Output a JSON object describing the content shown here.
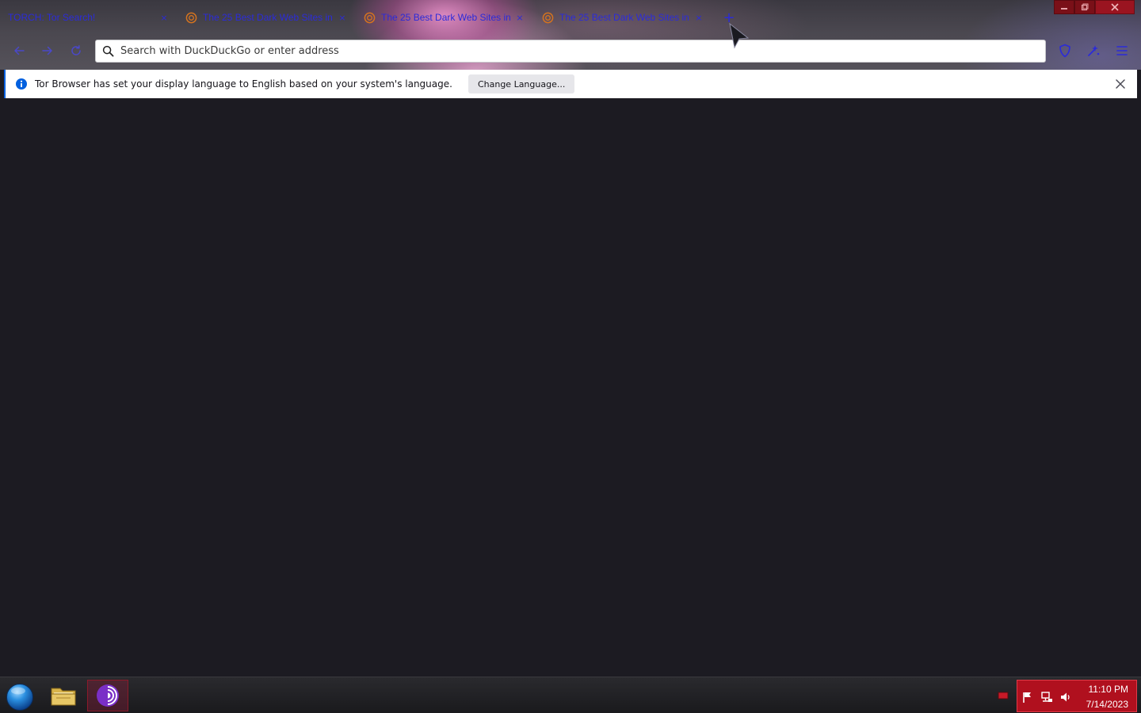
{
  "tabs": [
    {
      "title": "TORCH: Tor Search!",
      "has_favicon": false
    },
    {
      "title": "The 25 Best Dark Web Sites in ...",
      "has_favicon": true
    },
    {
      "title": "The 25 Best Dark Web Sites in ...",
      "has_favicon": true
    },
    {
      "title": "The 25 Best Dark Web Sites in ...",
      "has_favicon": true
    }
  ],
  "tab_close_glyph": "×",
  "new_tab_glyph": "+",
  "urlbar": {
    "placeholder": "Search with DuckDuckGo or enter address",
    "value": ""
  },
  "notification": {
    "message": "Tor Browser has set your display language to English based on your system's language.",
    "button_label": "Change Language..."
  },
  "taskbar": {
    "clock_time": "11:10 PM",
    "clock_date": "7/14/2023"
  },
  "colors": {
    "tab_text": "#2b2bd9",
    "content_bg": "#1c1b22",
    "tray_bg": "#b0101e",
    "info_blue": "#0060df",
    "tor_purple": "#7a2fc7"
  },
  "icons": {
    "back": "arrow-left-icon",
    "forward": "arrow-right-icon",
    "reload": "reload-icon",
    "search": "search-icon",
    "shield": "shield-icon",
    "tor_circuit": "tor-circuit-icon",
    "menu": "hamburger-menu-icon",
    "info": "info-icon",
    "close": "close-icon",
    "start": "start-orb-icon",
    "explorer": "folder-icon",
    "tor_browser": "tor-browser-icon"
  }
}
